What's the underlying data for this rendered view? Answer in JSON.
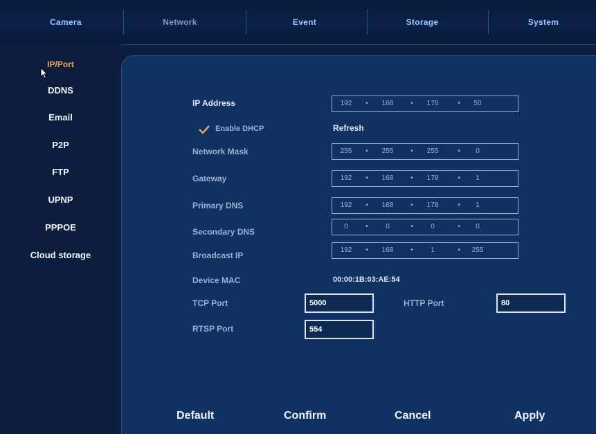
{
  "tabs": [
    {
      "label": "Camera",
      "active": false
    },
    {
      "label": "Network",
      "active": true
    },
    {
      "label": "Event",
      "active": false
    },
    {
      "label": "Storage",
      "active": false
    },
    {
      "label": "System",
      "active": false
    }
  ],
  "sidebar": {
    "items": [
      {
        "label": "IP/Port",
        "active": true
      },
      {
        "label": "DDNS",
        "active": false
      },
      {
        "label": "Email",
        "active": false
      },
      {
        "label": "P2P",
        "active": false
      },
      {
        "label": "FTP",
        "active": false
      },
      {
        "label": "UPNP",
        "active": false
      },
      {
        "label": "PPPOE",
        "active": false
      },
      {
        "label": "Cloud storage",
        "active": false
      }
    ]
  },
  "form": {
    "ip_address": {
      "label": "IP Address",
      "octets": [
        "192",
        "168",
        "178",
        "50"
      ]
    },
    "dhcp": {
      "label": "Enable DHCP",
      "checked": true,
      "refresh_label": "Refresh"
    },
    "network_mask": {
      "label": "Network Mask",
      "octets": [
        "255",
        "255",
        "255",
        "0"
      ]
    },
    "gateway": {
      "label": "Gateway",
      "octets": [
        "192",
        "168",
        "178",
        "1"
      ]
    },
    "primary_dns": {
      "label": "Primary DNS",
      "octets": [
        "192",
        "168",
        "178",
        "1"
      ]
    },
    "secondary_dns": {
      "label": "Secondary DNS",
      "octets": [
        "0",
        "0",
        "0",
        "0"
      ]
    },
    "broadcast_ip": {
      "label": "Broadcast IP",
      "octets": [
        "192",
        "168",
        "1",
        "255"
      ]
    },
    "device_mac": {
      "label": "Device MAC",
      "value": "00:00:1B:03:AE:54"
    },
    "tcp_port": {
      "label": "TCP Port",
      "value": "5000"
    },
    "http_port": {
      "label": "HTTP Port",
      "value": "80"
    },
    "rtsp_port": {
      "label": "RTSP Port",
      "value": "554"
    }
  },
  "buttons": {
    "default": "Default",
    "confirm": "Confirm",
    "cancel": "Cancel",
    "apply": "Apply"
  },
  "colors": {
    "background": "#0c1d3d",
    "panel": "#0f3262",
    "tab_text": "#9fc6ff",
    "active_sidebar": "#e6a65a",
    "check_mark": "#e6a65a"
  }
}
